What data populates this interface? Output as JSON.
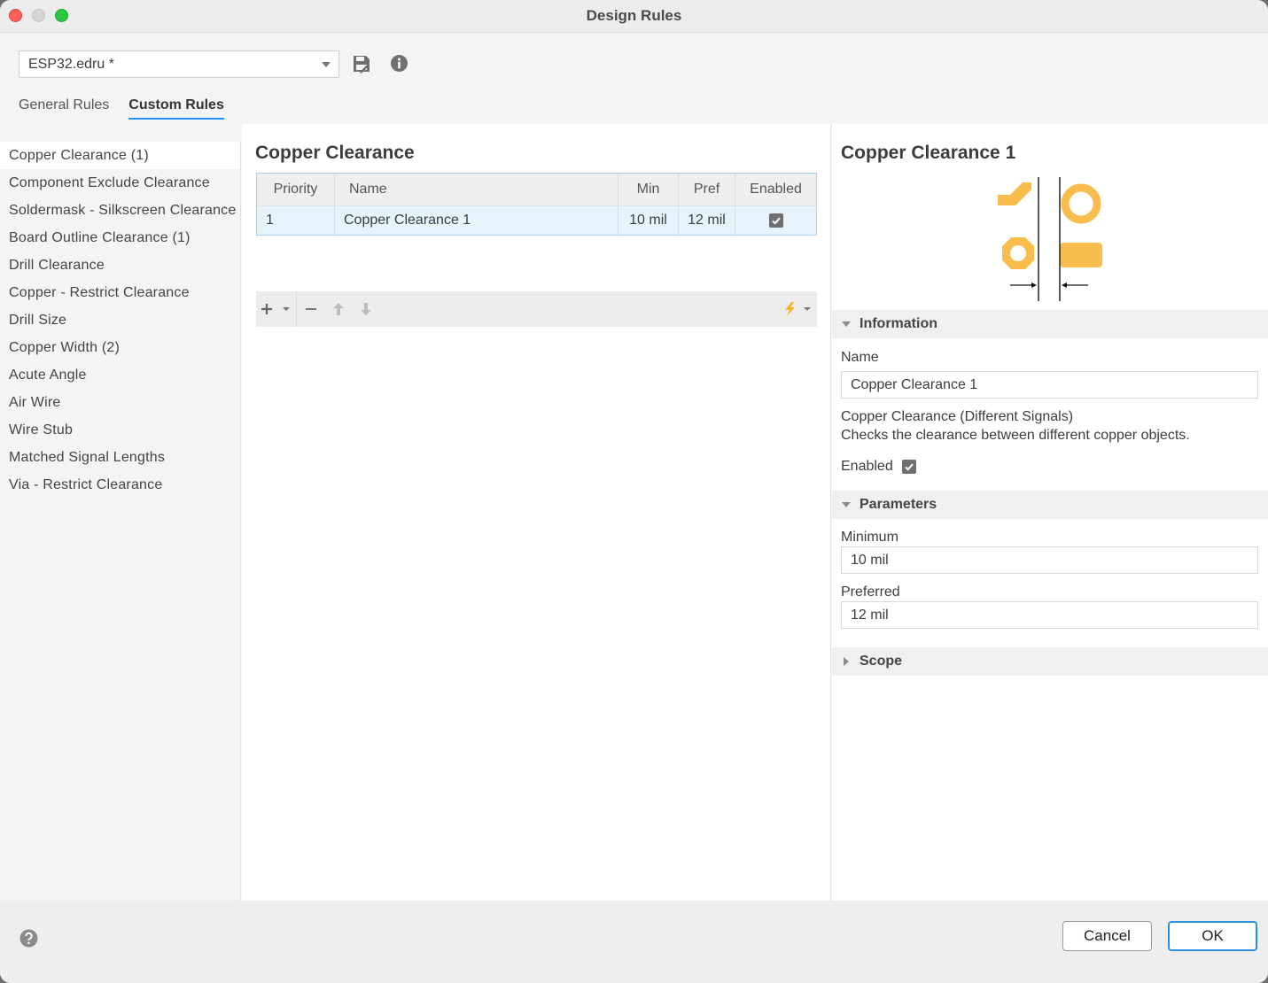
{
  "window": {
    "title": "Design Rules"
  },
  "file_select": {
    "value": "ESP32.edru *"
  },
  "icons": {
    "save": "save-floppy-icon",
    "info": "info-icon",
    "help": "help-icon"
  },
  "tabs": [
    {
      "label": "General Rules",
      "active": false
    },
    {
      "label": "Custom Rules",
      "active": true
    }
  ],
  "rules": [
    {
      "label": "Copper Clearance (1)",
      "selected": true
    },
    {
      "label": "Component Exclude Clearance"
    },
    {
      "label": "Soldermask - Silkscreen Clearance"
    },
    {
      "label": "Board Outline Clearance (1)"
    },
    {
      "label": "Drill Clearance"
    },
    {
      "label": "Copper - Restrict Clearance"
    },
    {
      "label": "Drill Size"
    },
    {
      "label": "Copper Width (2)"
    },
    {
      "label": "Acute Angle"
    },
    {
      "label": "Air Wire"
    },
    {
      "label": "Wire Stub"
    },
    {
      "label": "Matched Signal Lengths"
    },
    {
      "label": "Via - Restrict Clearance"
    }
  ],
  "middle": {
    "title": "Copper Clearance",
    "columns": {
      "priority": "Priority",
      "name": "Name",
      "min": "Min",
      "pref": "Pref",
      "enabled": "Enabled"
    },
    "rows": [
      {
        "priority": "1",
        "name": "Copper Clearance 1",
        "min": "10 mil",
        "pref": "12 mil",
        "enabled": true
      }
    ]
  },
  "details": {
    "title": "Copper Clearance 1",
    "information_header": "Information",
    "name_label": "Name",
    "name_value": "Copper Clearance 1",
    "desc_line1": "Copper Clearance (Different Signals)",
    "desc_line2": "Checks the clearance between different copper objects.",
    "enabled_label": "Enabled",
    "enabled": true,
    "parameters_header": "Parameters",
    "minimum_label": "Minimum",
    "minimum_value": "10 mil",
    "preferred_label": "Preferred",
    "preferred_value": "12 mil",
    "scope_header": "Scope"
  },
  "footer": {
    "cancel": "Cancel",
    "ok": "OK"
  },
  "colors": {
    "accent": "#2d8fe0",
    "copper": "#f9bd4d",
    "selection": "#e6f3fb"
  }
}
